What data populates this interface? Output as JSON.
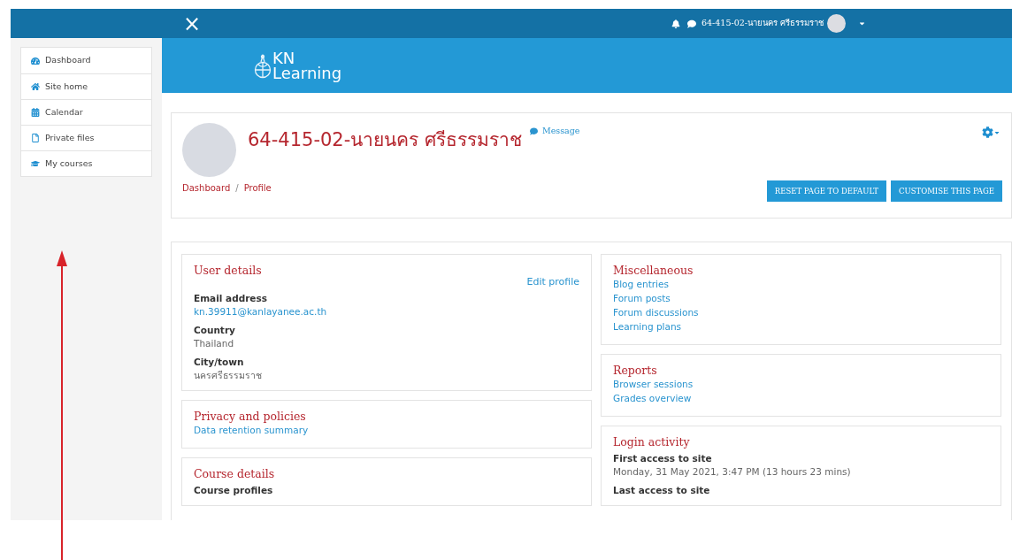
{
  "navbar": {
    "close_glyph": "×",
    "user_name": "64-415-02-นายนคร ศรีธรรมราช"
  },
  "sidebar": {
    "items": [
      {
        "label": "Dashboard",
        "selected": false
      },
      {
        "label": "Site home",
        "selected": false
      },
      {
        "label": "Calendar",
        "selected": false
      },
      {
        "label": "Private files",
        "selected": false
      },
      {
        "label": "My courses",
        "selected": false
      }
    ]
  },
  "logo": {
    "line1": "KN",
    "line2": "Learning"
  },
  "profile": {
    "name": "64-415-02-นายนคร ศรีธรรมราช",
    "message": "Message",
    "breadcrumb": [
      "Dashboard",
      "Profile"
    ],
    "breadcrumb_separator": "/",
    "buttons": [
      "RESET PAGE TO DEFAULT",
      "CUSTOMISE THIS PAGE"
    ]
  },
  "left_cards": [
    {
      "title": "User details",
      "action": "Edit profile",
      "fields": [
        {
          "label": "Email address",
          "value": "kn.39911@kanlayanee.ac.th",
          "kind": "link"
        },
        {
          "label": "Country",
          "value": "Thailand",
          "kind": "text"
        },
        {
          "label": "City/town",
          "value": "นครศรีธรรมราช",
          "kind": "text"
        }
      ]
    },
    {
      "title": "Privacy and policies",
      "links": [
        "Data retention summary"
      ]
    },
    {
      "title": "Course details",
      "fields": [
        {
          "label": "Course profiles",
          "kind": "label"
        }
      ]
    }
  ],
  "right_cards": [
    {
      "title": "Miscellaneous",
      "links": [
        "Blog entries",
        "Forum posts",
        "Forum discussions",
        "Learning plans"
      ]
    },
    {
      "title": "Reports",
      "links": [
        "Browser sessions",
        "Grades overview"
      ]
    },
    {
      "title": "Login activity",
      "fields": [
        {
          "label": "First access to site",
          "value": "Monday, 31 May 2021, 3:47 PM  (13 hours 23 mins)",
          "kind": "text"
        },
        {
          "label": "Last access to site",
          "kind": "label"
        }
      ]
    }
  ]
}
